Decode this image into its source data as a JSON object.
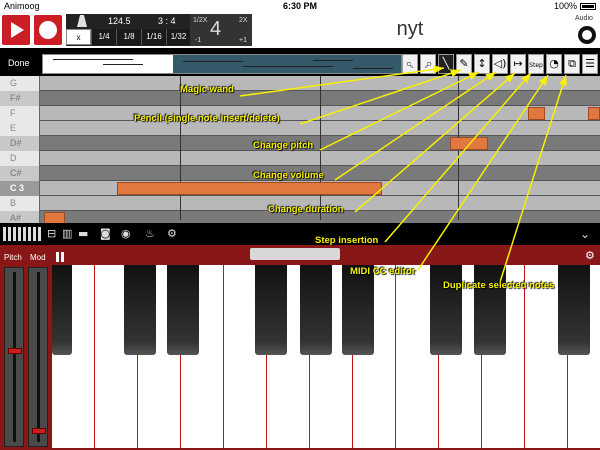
{
  "status_bar": {
    "carrier": "Animoog",
    "time": "6:30 PM",
    "battery": "100%"
  },
  "transport": {
    "tempo": "124.5",
    "time_signature": "3 : 4",
    "grid_buttons": [
      "x",
      "1/4",
      "1/8",
      "1/16",
      "1/32"
    ],
    "selected_grid": "x",
    "speed_labels": {
      "half": "1/2X",
      "double": "2X",
      "minus": "-1",
      "plus": "+1"
    },
    "speed_value": "4",
    "song_title": "nyt",
    "audio_label": "Audio"
  },
  "editor_toolbar": {
    "done_label": "Done",
    "tools": [
      {
        "name": "zoom-out-icon",
        "glyph": "🔍︎",
        "active": false
      },
      {
        "name": "zoom-in-icon",
        "glyph": "🔎︎",
        "active": false
      },
      {
        "name": "magic-wand-icon",
        "glyph": "╲",
        "active": true
      },
      {
        "name": "pencil-icon",
        "glyph": "✎",
        "active": false
      },
      {
        "name": "change-pitch-icon",
        "glyph": "↕",
        "active": false
      },
      {
        "name": "change-volume-icon",
        "glyph": "◁)",
        "active": false
      },
      {
        "name": "change-duration-icon",
        "glyph": "↦",
        "active": false
      },
      {
        "name": "step-insertion-icon",
        "glyph": "Step",
        "active": false
      },
      {
        "name": "midi-cc-icon",
        "glyph": "◔",
        "active": false
      },
      {
        "name": "duplicate-icon",
        "glyph": "⧉",
        "active": false
      },
      {
        "name": "menu-icon",
        "glyph": "☰",
        "active": false
      }
    ]
  },
  "piano_roll": {
    "rows": [
      "G",
      "F#",
      "F",
      "E",
      "D#",
      "D",
      "C#",
      "C 3",
      "B",
      "A#"
    ]
  },
  "annotations": [
    "Magic wand",
    "Pencil (single note insert/delete)",
    "Change pitch",
    "Change volume",
    "Change duration",
    "Step insertion",
    "MIDI CC editor",
    "Duplicate selected notes"
  ],
  "keyboard": {
    "pitch_label": "Pitch",
    "mod_label": "Mod"
  },
  "colors": {
    "accent": "#cc1d25",
    "note": "#e07840",
    "annotation": "#f7f000",
    "keyboard_bg": "#8a1717"
  }
}
